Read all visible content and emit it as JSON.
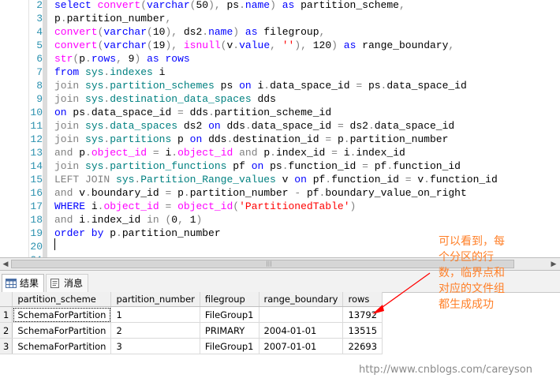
{
  "editor": {
    "lines": [
      {
        "n": "2",
        "segs": [
          [
            "kw",
            "select "
          ],
          [
            "fn",
            "convert"
          ],
          [
            "op",
            "("
          ],
          [
            "kw",
            "varchar"
          ],
          [
            "op",
            "("
          ],
          [
            "pl",
            "50"
          ],
          [
            "op",
            "), "
          ],
          [
            "pl",
            "ps"
          ],
          [
            "op",
            "."
          ],
          [
            "kw",
            "name"
          ],
          [
            "op",
            ") "
          ],
          [
            "kw",
            "as"
          ],
          [
            "pl",
            " partition_scheme"
          ],
          [
            "op",
            ","
          ]
        ]
      },
      {
        "n": "3",
        "segs": [
          [
            "pl",
            "p"
          ],
          [
            "op",
            "."
          ],
          [
            "pl",
            "partition_number"
          ],
          [
            "op",
            ","
          ]
        ]
      },
      {
        "n": "4",
        "segs": [
          [
            "fn",
            "convert"
          ],
          [
            "op",
            "("
          ],
          [
            "kw",
            "varchar"
          ],
          [
            "op",
            "("
          ],
          [
            "pl",
            "10"
          ],
          [
            "op",
            "), "
          ],
          [
            "pl",
            "ds2"
          ],
          [
            "op",
            "."
          ],
          [
            "kw",
            "name"
          ],
          [
            "op",
            ") "
          ],
          [
            "kw",
            "as"
          ],
          [
            "pl",
            " filegroup"
          ],
          [
            "op",
            ","
          ]
        ]
      },
      {
        "n": "5",
        "segs": [
          [
            "fn",
            "convert"
          ],
          [
            "op",
            "("
          ],
          [
            "kw",
            "varchar"
          ],
          [
            "op",
            "("
          ],
          [
            "pl",
            "19"
          ],
          [
            "op",
            "), "
          ],
          [
            "fn",
            "isnull"
          ],
          [
            "op",
            "("
          ],
          [
            "pl",
            "v"
          ],
          [
            "op",
            "."
          ],
          [
            "kw",
            "value"
          ],
          [
            "op",
            ", "
          ],
          [
            "str",
            "''"
          ],
          [
            "op",
            "), "
          ],
          [
            "pl",
            "120"
          ],
          [
            "op",
            ") "
          ],
          [
            "kw",
            "as"
          ],
          [
            "pl",
            " range_boundary"
          ],
          [
            "op",
            ","
          ]
        ]
      },
      {
        "n": "6",
        "segs": [
          [
            "fn",
            "str"
          ],
          [
            "op",
            "("
          ],
          [
            "pl",
            "p"
          ],
          [
            "op",
            "."
          ],
          [
            "kw",
            "rows"
          ],
          [
            "op",
            ", "
          ],
          [
            "pl",
            "9"
          ],
          [
            "op",
            ") "
          ],
          [
            "kw",
            "as"
          ],
          [
            "kw",
            " rows"
          ]
        ]
      },
      {
        "n": "7",
        "segs": [
          [
            "kw",
            "from "
          ],
          [
            "tbl",
            "sys"
          ],
          [
            "op",
            "."
          ],
          [
            "tbl",
            "indexes"
          ],
          [
            "pl",
            " i"
          ]
        ]
      },
      {
        "n": "8",
        "segs": [
          [
            "op",
            "join "
          ],
          [
            "tbl",
            "sys"
          ],
          [
            "op",
            "."
          ],
          [
            "tbl",
            "partition_schemes"
          ],
          [
            "pl",
            " ps "
          ],
          [
            "kw",
            "on"
          ],
          [
            "pl",
            " i"
          ],
          [
            "op",
            "."
          ],
          [
            "pl",
            "data_space_id "
          ],
          [
            "op",
            "="
          ],
          [
            "pl",
            " ps"
          ],
          [
            "op",
            "."
          ],
          [
            "pl",
            "data_space_id"
          ]
        ]
      },
      {
        "n": "9",
        "segs": [
          [
            "op",
            "join "
          ],
          [
            "tbl",
            "sys"
          ],
          [
            "op",
            "."
          ],
          [
            "tbl",
            "destination_data_spaces"
          ],
          [
            "pl",
            " dds"
          ]
        ]
      },
      {
        "n": "10",
        "segs": [
          [
            "kw",
            "on"
          ],
          [
            "pl",
            " ps"
          ],
          [
            "op",
            "."
          ],
          [
            "pl",
            "data_space_id "
          ],
          [
            "op",
            "="
          ],
          [
            "pl",
            " dds"
          ],
          [
            "op",
            "."
          ],
          [
            "pl",
            "partition_scheme_id"
          ]
        ]
      },
      {
        "n": "11",
        "segs": [
          [
            "op",
            "join "
          ],
          [
            "tbl",
            "sys"
          ],
          [
            "op",
            "."
          ],
          [
            "tbl",
            "data_spaces"
          ],
          [
            "pl",
            " ds2 "
          ],
          [
            "kw",
            "on"
          ],
          [
            "pl",
            " dds"
          ],
          [
            "op",
            "."
          ],
          [
            "pl",
            "data_space_id "
          ],
          [
            "op",
            "="
          ],
          [
            "pl",
            " ds2"
          ],
          [
            "op",
            "."
          ],
          [
            "pl",
            "data_space_id"
          ]
        ]
      },
      {
        "n": "12",
        "segs": [
          [
            "op",
            "join "
          ],
          [
            "tbl",
            "sys"
          ],
          [
            "op",
            "."
          ],
          [
            "tbl",
            "partitions"
          ],
          [
            "pl",
            " p "
          ],
          [
            "kw",
            "on"
          ],
          [
            "pl",
            " dds"
          ],
          [
            "op",
            "."
          ],
          [
            "pl",
            "destination_id "
          ],
          [
            "op",
            "="
          ],
          [
            "pl",
            " p"
          ],
          [
            "op",
            "."
          ],
          [
            "pl",
            "partition_number"
          ]
        ]
      },
      {
        "n": "13",
        "segs": [
          [
            "op",
            "and "
          ],
          [
            "pl",
            "p"
          ],
          [
            "op",
            "."
          ],
          [
            "fn",
            "object_id"
          ],
          [
            "op",
            " = "
          ],
          [
            "pl",
            "i"
          ],
          [
            "op",
            "."
          ],
          [
            "fn",
            "object_id"
          ],
          [
            "op",
            " and "
          ],
          [
            "pl",
            "p"
          ],
          [
            "op",
            "."
          ],
          [
            "pl",
            "index_id "
          ],
          [
            "op",
            "="
          ],
          [
            "pl",
            " i"
          ],
          [
            "op",
            "."
          ],
          [
            "pl",
            "index_id"
          ]
        ]
      },
      {
        "n": "14",
        "segs": [
          [
            "op",
            "join "
          ],
          [
            "tbl",
            "sys"
          ],
          [
            "op",
            "."
          ],
          [
            "tbl",
            "partition_functions"
          ],
          [
            "pl",
            " pf "
          ],
          [
            "kw",
            "on"
          ],
          [
            "pl",
            " ps"
          ],
          [
            "op",
            "."
          ],
          [
            "pl",
            "function_id "
          ],
          [
            "op",
            "="
          ],
          [
            "pl",
            " pf"
          ],
          [
            "op",
            "."
          ],
          [
            "pl",
            "function_id"
          ]
        ]
      },
      {
        "n": "15",
        "segs": [
          [
            "op",
            "LEFT JOIN "
          ],
          [
            "tbl",
            "sys"
          ],
          [
            "op",
            "."
          ],
          [
            "tbl",
            "Partition_Range_values"
          ],
          [
            "pl",
            " v "
          ],
          [
            "kw",
            "on"
          ],
          [
            "pl",
            " pf"
          ],
          [
            "op",
            "."
          ],
          [
            "pl",
            "function_id "
          ],
          [
            "op",
            "="
          ],
          [
            "pl",
            " v"
          ],
          [
            "op",
            "."
          ],
          [
            "pl",
            "function_id"
          ]
        ]
      },
      {
        "n": "16",
        "segs": [
          [
            "op",
            "and "
          ],
          [
            "pl",
            "v"
          ],
          [
            "op",
            "."
          ],
          [
            "pl",
            "boundary_id "
          ],
          [
            "op",
            "="
          ],
          [
            "pl",
            " p"
          ],
          [
            "op",
            "."
          ],
          [
            "pl",
            "partition_number "
          ],
          [
            "op",
            "-"
          ],
          [
            "pl",
            " pf"
          ],
          [
            "op",
            "."
          ],
          [
            "pl",
            "boundary_value_on_right"
          ]
        ]
      },
      {
        "n": "17",
        "segs": [
          [
            "kw",
            "WHERE "
          ],
          [
            "pl",
            "i"
          ],
          [
            "op",
            "."
          ],
          [
            "fn",
            "object_id"
          ],
          [
            "op",
            " = "
          ],
          [
            "fn",
            "object_id"
          ],
          [
            "op",
            "("
          ],
          [
            "str",
            "'PartitionedTable'"
          ],
          [
            "op",
            ")"
          ]
        ]
      },
      {
        "n": "18",
        "segs": [
          [
            "op",
            "and "
          ],
          [
            "pl",
            "i"
          ],
          [
            "op",
            "."
          ],
          [
            "pl",
            "index_id "
          ],
          [
            "op",
            "in"
          ],
          [
            "op",
            " ("
          ],
          [
            "pl",
            "0"
          ],
          [
            "op",
            ", "
          ],
          [
            "pl",
            "1"
          ],
          [
            "op",
            ")"
          ]
        ]
      },
      {
        "n": "19",
        "segs": [
          [
            "kw",
            "order by "
          ],
          [
            "pl",
            "p"
          ],
          [
            "op",
            "."
          ],
          [
            "pl",
            "partition_number"
          ]
        ]
      },
      {
        "n": "20",
        "segs": []
      },
      {
        "n": "21",
        "segs": []
      }
    ]
  },
  "tabs": [
    {
      "label": "结果",
      "icon": "grid-icon",
      "active": true
    },
    {
      "label": "消息",
      "icon": "message-icon",
      "active": false
    }
  ],
  "results": {
    "columns": [
      "partition_scheme",
      "partition_number",
      "filegroup",
      "range_boundary",
      "rows"
    ],
    "rows": [
      [
        "1",
        "SchemaForPartition",
        "1",
        "FileGroup1",
        "",
        "13792"
      ],
      [
        "2",
        "SchemaForPartition",
        "2",
        "PRIMARY",
        "2004-01-01",
        "13515"
      ],
      [
        "3",
        "SchemaForPartition",
        "3",
        "FileGroup1",
        "2007-01-01",
        "22693"
      ]
    ]
  },
  "annotation": {
    "text": "可以看到，每个分区的行数，临界点和对应的文件组都生成成功",
    "color": "#ff7f27",
    "arrow_color": "#ff0000"
  },
  "watermark": "http://www.cnblogs.com/careyson"
}
